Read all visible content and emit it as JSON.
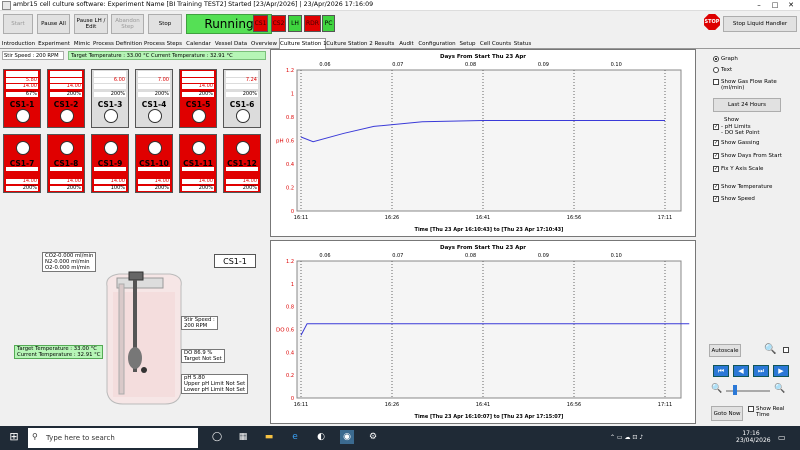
{
  "window": {
    "title": "ambr15 cell culture software: Experiment Name [BI Training TEST2] Started [23/Apr/2026] | 23/Apr/2026 17:16:09"
  },
  "toolbar": {
    "start": "Start",
    "pause_all": "Pause All",
    "pause_lh": "Pause LH / Edit",
    "abandon": "Abandon Step",
    "stop": "Stop",
    "status": "Running",
    "indicators": [
      "CS1",
      "CS2",
      "LH",
      "RDR",
      "PC"
    ],
    "stop_liquid_handler": "Stop Liquid Handler",
    "stop_sign": "STOP"
  },
  "tabs": [
    "Introduction",
    "Experiment",
    "Mimic",
    "Process Definition",
    "Process Steps",
    "Calendar",
    "Vessel Data",
    "Overview",
    "Culture Station 1",
    "Culture Station 2",
    "Results",
    "Audit",
    "Configuration",
    "Setup",
    "Cell Counts",
    "Status"
  ],
  "active_tab": "Culture Station 1",
  "status": {
    "stir": "Stir Speed : 200 RPM",
    "temperature": "Target Temperature : 33.00 °C Current Temperature : 32.91 °C"
  },
  "stations_row1": [
    {
      "name": "CS1-1",
      "ph": "5.80",
      "temp": "14.00",
      "pct": "67%",
      "state": "red"
    },
    {
      "name": "CS1-2",
      "ph": "",
      "temp": "14.00",
      "pct": "200%",
      "state": "red"
    },
    {
      "name": "CS1-3",
      "ph": "6.00",
      "temp": "",
      "pct": "200%",
      "state": "grey"
    },
    {
      "name": "CS1-4",
      "ph": "7.00",
      "temp": "",
      "pct": "200%",
      "state": "grey"
    },
    {
      "name": "CS1-5",
      "ph": "",
      "temp": "14.00",
      "pct": "200%",
      "state": "red"
    },
    {
      "name": "CS1-6",
      "ph": "7.24",
      "temp": "",
      "pct": "200%",
      "state": "grey"
    }
  ],
  "stations_row2": [
    {
      "name": "CS1-7",
      "temp": "14.00",
      "pct": "200%"
    },
    {
      "name": "CS1-8",
      "temp": "14.00",
      "pct": "200%"
    },
    {
      "name": "CS1-9",
      "temp": "14.00",
      "pct": "100%"
    },
    {
      "name": "CS1-10",
      "temp": "14.00",
      "pct": "200%"
    },
    {
      "name": "CS1-11",
      "temp": "14.00",
      "pct": "200%"
    },
    {
      "name": "CS1-12",
      "temp": "14.00",
      "pct": "200%"
    }
  ],
  "vessel": {
    "title": "CS1-1",
    "gas": [
      "CO2-0.000 ml/min",
      "N2-0.000 ml/min",
      "O2-0.000 ml/min"
    ],
    "temp": [
      "Target Temperature : 33.00 °C",
      "Current Temperature : 32.91 °C"
    ],
    "stir": [
      "Stir Speed :",
      "200 RPM"
    ],
    "do": [
      "DO 86.9 %",
      "Target Not Set"
    ],
    "ph": [
      "pH 5.80",
      "Upper pH Limit Not Set",
      "Lower pH Limit Not Set"
    ]
  },
  "chart_data": [
    {
      "type": "line",
      "title": "Days From Start Thu 23 Apr",
      "top_ticks": [
        "0.06",
        "0.07",
        "0.08",
        "0.09",
        "0.10"
      ],
      "bottom_ticks": [
        "16:11",
        "16:26",
        "16:41",
        "16:56",
        "17:11"
      ],
      "xlabel": "Time [Thu 23 Apr 16:10:43] to [Thu 23 Apr 17:10:43]",
      "ylabel": "pH",
      "ylim": [
        0,
        1.2
      ],
      "yticks": [
        "0",
        "0.2",
        "0.4",
        "0.6",
        "0.8",
        "1",
        "1.2"
      ],
      "series": [
        {
          "x": [
            "16:11",
            "16:13",
            "16:18",
            "16:23",
            "16:31",
            "16:41",
            "17:11"
          ],
          "values": [
            0.63,
            0.59,
            0.66,
            0.72,
            0.76,
            0.77,
            0.77
          ]
        }
      ]
    },
    {
      "type": "line",
      "title": "Days From Start Thu 23 Apr",
      "top_ticks": [
        "0.06",
        "0.07",
        "0.08",
        "0.09",
        "0.10"
      ],
      "bottom_ticks": [
        "16:11",
        "16:26",
        "16:41",
        "16:56",
        "17:11"
      ],
      "xlabel": "Time [Thu 23 Apr 16:10:07] to [Thu 23 Apr 17:15:07]",
      "ylabel": "DO",
      "ylim": [
        0,
        1.2
      ],
      "yticks": [
        "0",
        "0.2",
        "0.4",
        "0.6",
        "0.8",
        "1",
        "1.2"
      ],
      "series": [
        {
          "x": [
            "16:11",
            "16:12",
            "17:15"
          ],
          "values": [
            0.55,
            0.65,
            0.65
          ]
        }
      ]
    }
  ],
  "options": {
    "graph": "Graph",
    "text": "Text",
    "show_gas_flow": "Show Gas Flow Rate (ml/min)",
    "last24": "Last 24 Hours",
    "show": "Show",
    "ph_limits": "- pH Limits",
    "do_set": "- DO Set Point",
    "gassing": "Show Gassing",
    "days_from_start": "Show Days From Start",
    "fix_y": "Fix Y Axis Scale",
    "show_temp": "Show Temperature",
    "show_speed": "Show Speed",
    "autoscale": "Autoscale",
    "goto_now": "Goto Now",
    "show_real_time": "Show Real Time"
  },
  "taskbar": {
    "search_placeholder": "Type here to search",
    "time": "17:16",
    "date": "23/04/2026"
  }
}
